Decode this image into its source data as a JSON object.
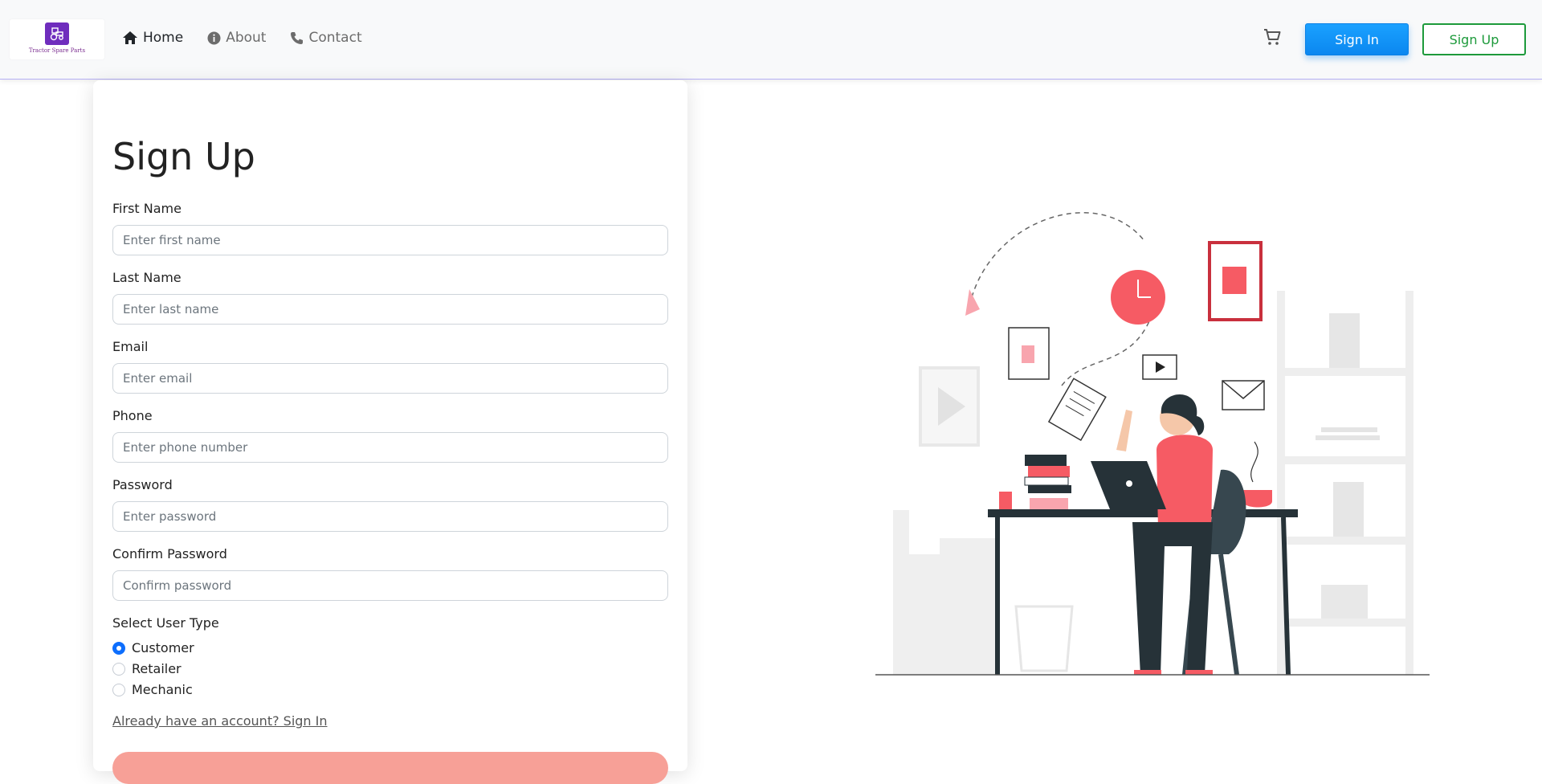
{
  "brand": {
    "name": "Tractor Spare Parts",
    "logo_icon": "tractor-icon",
    "logo_color": "#6f2dbd"
  },
  "nav": {
    "links": [
      {
        "label": "Home",
        "icon": "home-icon",
        "active": true
      },
      {
        "label": "About",
        "icon": "info-icon",
        "active": false
      },
      {
        "label": "Contact",
        "icon": "phone-icon",
        "active": false
      }
    ],
    "cart_icon": "cart-icon",
    "signin_label": "Sign In",
    "signup_label": "Sign Up"
  },
  "form": {
    "title": "Sign Up",
    "fields": [
      {
        "label": "First Name",
        "placeholder": "Enter first name"
      },
      {
        "label": "Last Name",
        "placeholder": "Enter last name"
      },
      {
        "label": "Email",
        "placeholder": "Enter email"
      },
      {
        "label": "Phone",
        "placeholder": "Enter phone number"
      },
      {
        "label": "Password",
        "placeholder": "Enter password"
      },
      {
        "label": "Confirm Password",
        "placeholder": "Confirm password"
      }
    ],
    "user_type_label": "Select User Type",
    "user_types": [
      {
        "label": "Customer",
        "checked": true
      },
      {
        "label": "Retailer",
        "checked": false
      },
      {
        "label": "Mechanic",
        "checked": false
      }
    ],
    "signin_link": "Already have an account? Sign In"
  },
  "colors": {
    "primary": "#0b87f0",
    "success": "#1d9a3b",
    "accent": "#f65b64",
    "submit": "#f7a097"
  }
}
